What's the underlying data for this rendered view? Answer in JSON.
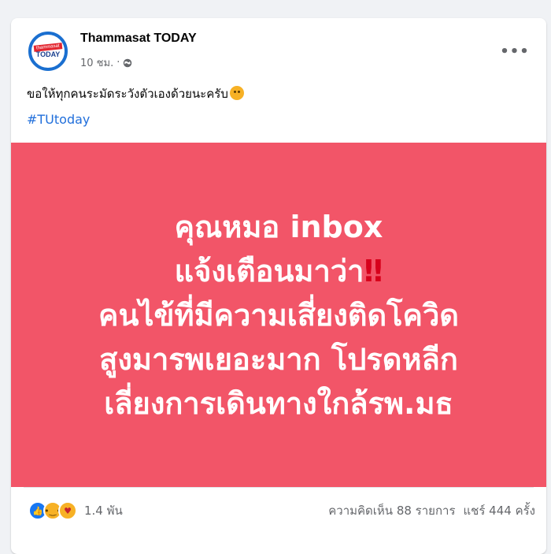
{
  "post": {
    "page_name": "Thammasat TODAY",
    "avatar": {
      "top_text": "thammasat",
      "bottom_text": "TODAY"
    },
    "time": "10 ชม.",
    "separator": "·",
    "visibility_icon": "globe-icon",
    "more_icon": "more-icon",
    "more_label": "•••",
    "caption": "ขอให้ทุกคนระมัดระวังตัวเองด้วยนะครับ",
    "caption_emoji": "sad-face-emoji",
    "hashtag": "#TUtoday",
    "image": {
      "background_color": "#f25568",
      "lines": [
        "คุณหมอ inbox",
        "แจ้งเตือนมาว่า",
        "คนไข้ที่มีความเสี่ยงติดโควิด",
        "สูงมารพเยอะมาก โปรดหลีก",
        "เลี่ยงการเดินทางใกล้รพ.มธ"
      ],
      "exclaim": "‼"
    },
    "reactions": {
      "icons": [
        "like-icon",
        "sad-icon",
        "care-icon"
      ],
      "count": "1.4 พัน"
    },
    "comments": "ความคิดเห็น 88 รายการ",
    "shares": "แชร์ 444 ครั้ง"
  }
}
